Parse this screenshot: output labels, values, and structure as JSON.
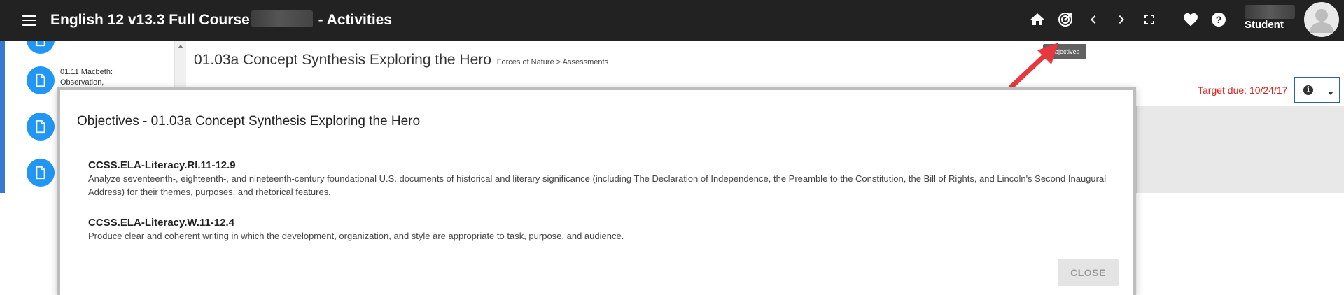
{
  "header": {
    "title_prefix": "English 12 v13.3 Full Course",
    "title_suffix": "- Activities",
    "user_role": "Student"
  },
  "sidebar": {
    "items": [
      {
        "label": "01.11 Macbeth: Observation,"
      }
    ]
  },
  "main": {
    "page_title": "01.03a Concept Synthesis Exploring the Hero",
    "breadcrumb": "Forces of Nature > Assessments",
    "target_due": "Target due: 10/24/17"
  },
  "tooltip": {
    "text": "Objectives"
  },
  "dialog": {
    "title": "Objectives - 01.03a Concept Synthesis Exploring the Hero",
    "objectives": [
      {
        "code": "CCSS.ELA-Literacy.RI.11-12.9",
        "description": "Analyze seventeenth-, eighteenth-, and nineteenth-century foundational U.S. documents of historical and literary significance (including The Declaration of Independence, the Preamble to the Constitution, the Bill of Rights, and Lincoln's Second Inaugural Address) for their themes, purposes, and rhetorical features."
      },
      {
        "code": "CCSS.ELA-Literacy.W.11-12.4",
        "description": "Produce clear and coherent writing in which the development, organization, and style are appropriate to task, purpose, and audience."
      }
    ],
    "close_label": "CLOSE"
  },
  "colors": {
    "topbar": "#222222",
    "accent_blue": "#2196f3",
    "due_red": "#e0201f",
    "arrow_red": "#e8383d"
  },
  "icons": [
    "menu-icon",
    "home-icon",
    "objectives-icon",
    "chevron-left-icon",
    "chevron-right-icon",
    "fullscreen-icon",
    "heart-icon",
    "help-icon",
    "avatar-icon",
    "document-icon",
    "info-icon",
    "caret-down-icon"
  ]
}
